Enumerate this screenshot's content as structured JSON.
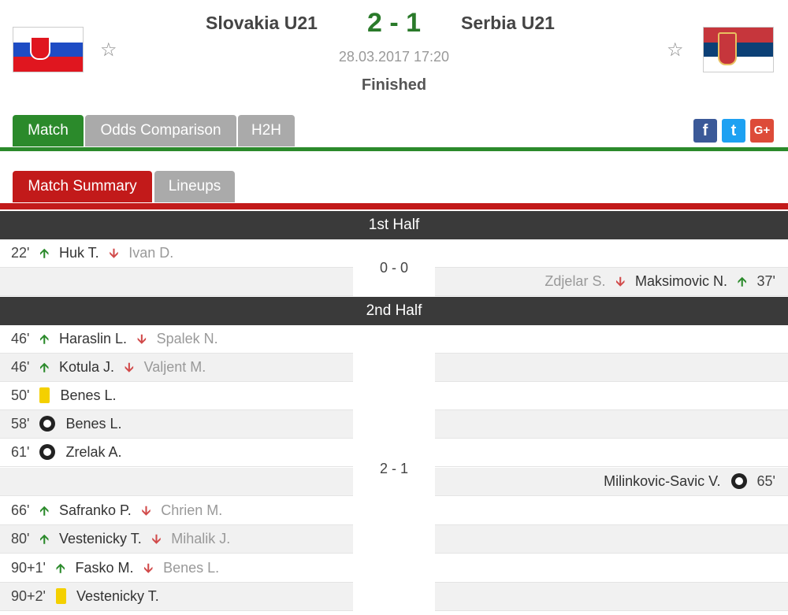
{
  "match": {
    "home_team": "Slovakia U21",
    "away_team": "Serbia U21",
    "score": "2 - 1",
    "datetime": "28.03.2017 17:20",
    "status": "Finished"
  },
  "colors": {
    "accent_green": "#2b8a2b",
    "accent_red": "#c21a1a",
    "header_dark": "#3a3a3a"
  },
  "tabs": [
    "Match",
    "Odds Comparison",
    "H2H"
  ],
  "subtabs": [
    "Match Summary",
    "Lineups"
  ],
  "social": {
    "facebook": "f",
    "twitter": "t",
    "google": "G+"
  },
  "halves": [
    {
      "title": "1st Half",
      "score": "0 - 0"
    },
    {
      "title": "2nd Half",
      "score": "2 - 1"
    }
  ],
  "events": {
    "e1": {
      "minute": "22'",
      "player": "Huk T.",
      "sub": "Ivan D."
    },
    "e2": {
      "minute": "37'",
      "player": "Maksimovic N.",
      "sub": "Zdjelar S."
    },
    "e3": {
      "minute": "46'",
      "player": "Haraslin L.",
      "sub": "Spalek N."
    },
    "e4": {
      "minute": "46'",
      "player": "Kotula J.",
      "sub": "Valjent M."
    },
    "e5": {
      "minute": "50'",
      "player": "Benes L."
    },
    "e6": {
      "minute": "58'",
      "player": "Benes L."
    },
    "e7": {
      "minute": "61'",
      "player": "Zrelak A."
    },
    "e8": {
      "minute": "65'",
      "player": "Milinkovic-Savic V."
    },
    "e9": {
      "minute": "66'",
      "player": "Safranko P.",
      "sub": "Chrien M."
    },
    "e10": {
      "minute": "80'",
      "player": "Vestenicky T.",
      "sub": "Mihalik J."
    },
    "e11": {
      "minute": "90+1'",
      "player": "Fasko M.",
      "sub": "Benes L."
    },
    "e12": {
      "minute": "90+2'",
      "player": "Vestenicky T."
    }
  }
}
